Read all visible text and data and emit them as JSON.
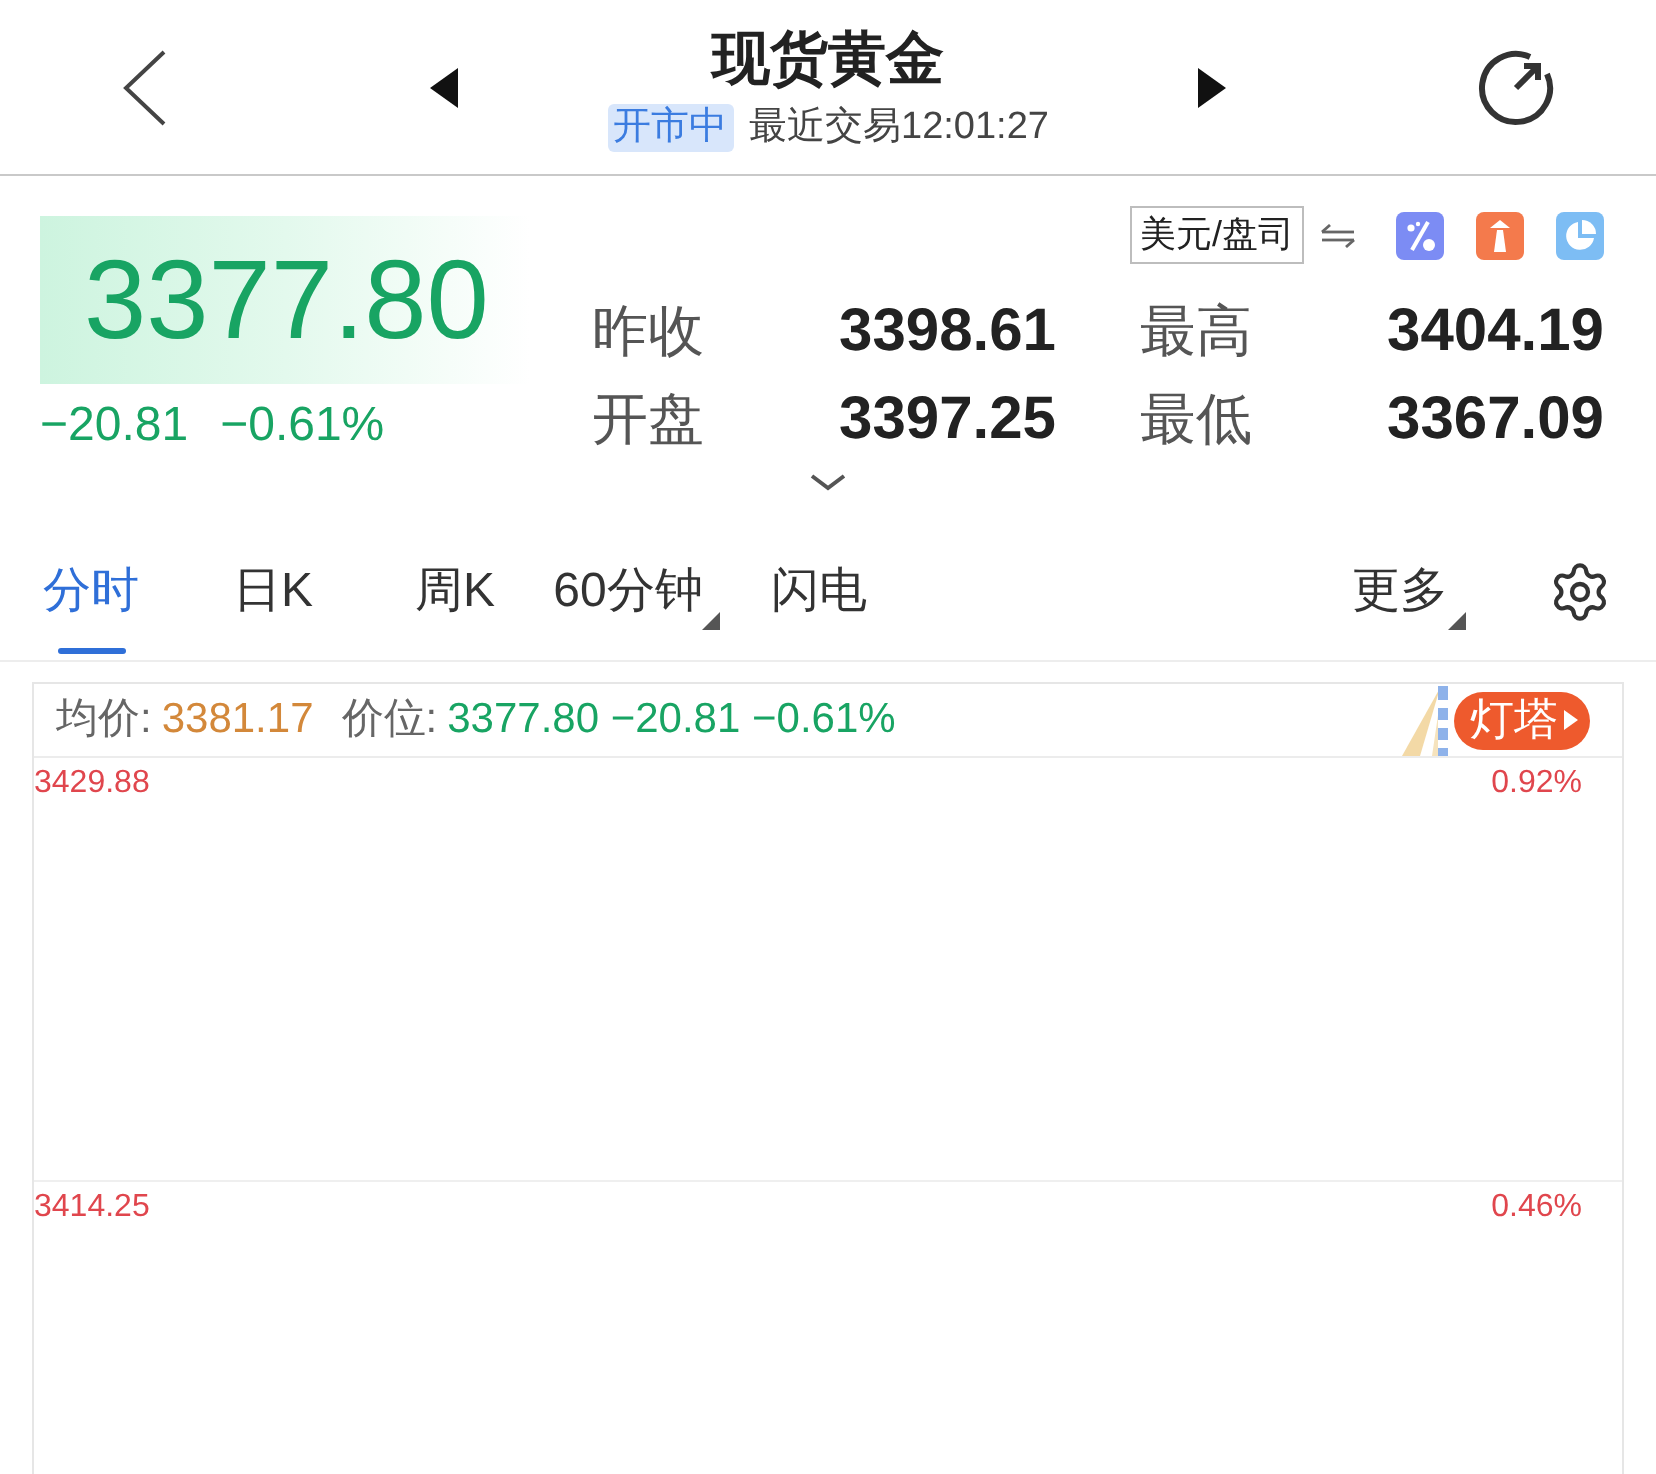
{
  "header": {
    "title": "现货黄金",
    "market_status": "开市中",
    "last_trade": "最近交易12:01:27"
  },
  "quote": {
    "price": "3377.80",
    "change": "−20.81",
    "change_percent": "−0.61%",
    "unit": "美元/盘司",
    "stats": [
      {
        "label": "昨收",
        "value": "3398.61"
      },
      {
        "label": "最高",
        "value": "3404.19"
      },
      {
        "label": "开盘",
        "value": "3397.25"
      },
      {
        "label": "最低",
        "value": "3367.09"
      }
    ]
  },
  "tabs": [
    {
      "label": "分时",
      "selected": true,
      "dropdown": false
    },
    {
      "label": "日K",
      "selected": false,
      "dropdown": false
    },
    {
      "label": "周K",
      "selected": false,
      "dropdown": false
    },
    {
      "label": "60分钟",
      "selected": false,
      "dropdown": true
    },
    {
      "label": "闪电",
      "selected": false,
      "dropdown": false
    }
  ],
  "more_button": {
    "label": "更多",
    "dropdown": true
  },
  "chart": {
    "avg_label": "均价:",
    "avg_value": "3381.17",
    "price_label": "价位:",
    "price_value": "3377.80 −20.81 −0.61%",
    "lighthouse_label": "灯塔",
    "gridlines": [
      {
        "price": "3429.88",
        "percent": "0.92%"
      },
      {
        "price": "3414.25",
        "percent": "0.46%"
      }
    ]
  }
}
